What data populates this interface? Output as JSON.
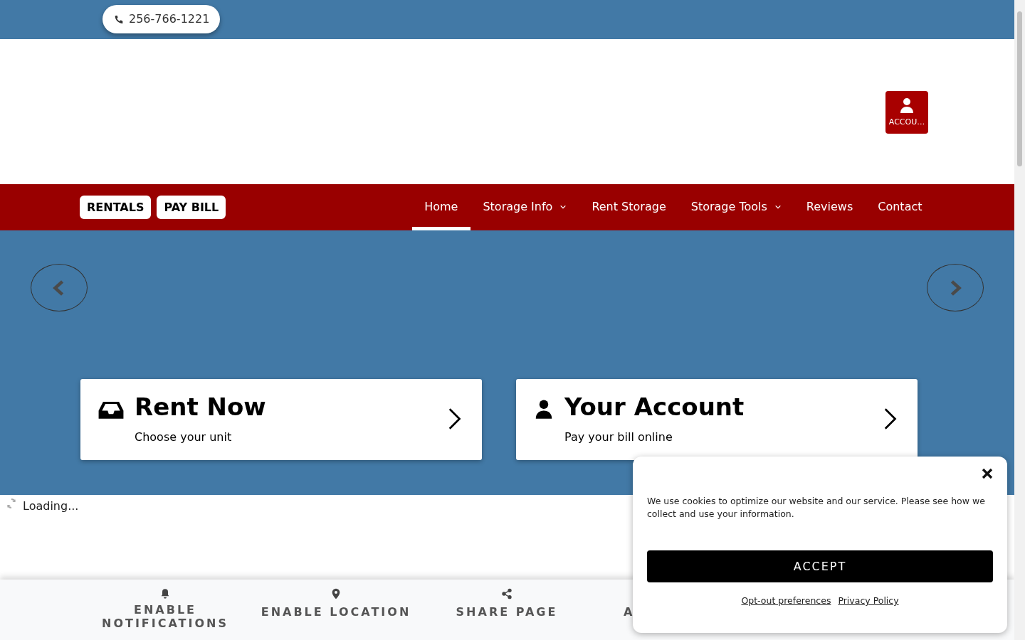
{
  "top_bar": {
    "phone": "256-766-1221"
  },
  "header": {
    "account_button": "ACCOU…"
  },
  "nav": {
    "buttons": [
      "RENTALS",
      "PAY BILL"
    ],
    "items": [
      {
        "label": "Home",
        "selected": true,
        "dropdown": false
      },
      {
        "label": "Storage Info",
        "selected": false,
        "dropdown": true
      },
      {
        "label": "Rent Storage",
        "selected": false,
        "dropdown": false
      },
      {
        "label": "Storage Tools",
        "selected": false,
        "dropdown": true
      },
      {
        "label": "Reviews",
        "selected": false,
        "dropdown": false
      },
      {
        "label": "Contact",
        "selected": false,
        "dropdown": false
      }
    ]
  },
  "hero": {
    "cards": [
      {
        "kind": "rent",
        "title": "Rent Now",
        "subtitle": "Choose your unit"
      },
      {
        "kind": "account",
        "title": "Your Account",
        "subtitle": "Pay your bill online"
      }
    ]
  },
  "loading": "Loading...",
  "bottom_bar": {
    "items": [
      {
        "kind": "notifications",
        "label": "ENABLE NOTIFICATIONS"
      },
      {
        "kind": "location",
        "label": "ENABLE LOCATION"
      },
      {
        "kind": "share",
        "label": "SHARE PAGE"
      },
      {
        "kind": "other",
        "label": "A"
      }
    ]
  },
  "cookie_banner": {
    "message": "We use cookies to optimize our website and our service. Please see how we collect and use your information.",
    "accept": "ACCEPT",
    "links": [
      "Opt-out preferences",
      "Privacy Policy"
    ]
  }
}
